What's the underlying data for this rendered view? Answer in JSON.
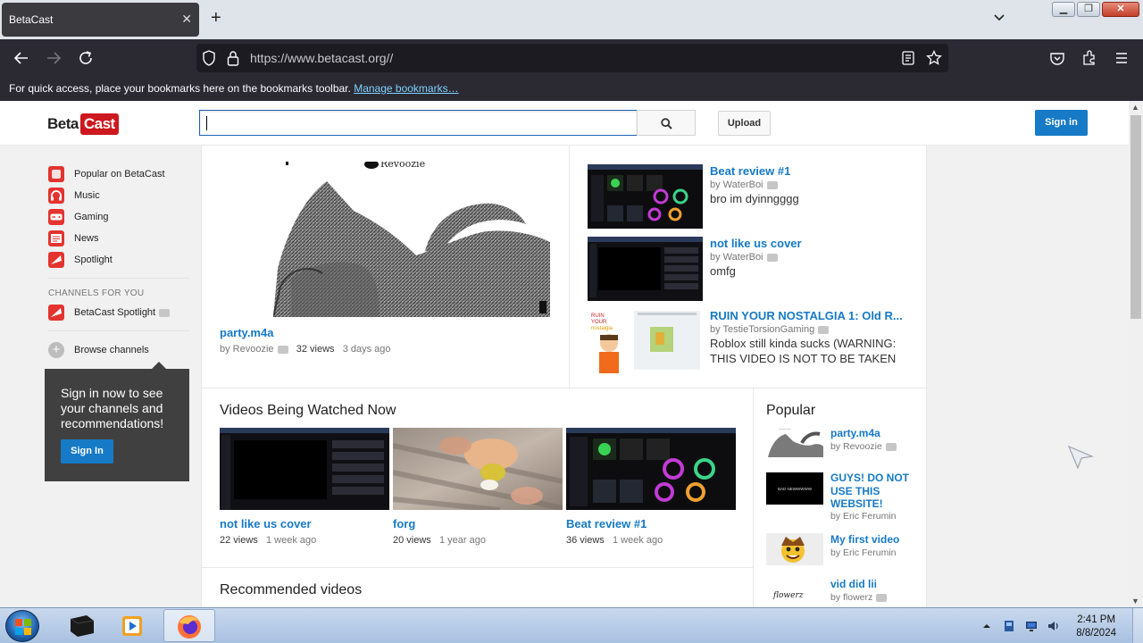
{
  "browser": {
    "tab_title": "BetaCast",
    "tab_close": "✕",
    "new_tab": "+",
    "url": "https://www.betacast.org//",
    "bookmarks_text": "For quick access, place your bookmarks here on the bookmarks toolbar.",
    "bookmarks_link": "Manage bookmarks…"
  },
  "header": {
    "logo_left": "Beta",
    "logo_right": "Cast",
    "search_placeholder": "",
    "upload_label": "Upload",
    "signin_label": "Sign in"
  },
  "guide": {
    "items": [
      {
        "label": "Popular on BetaCast",
        "icon": "popular-icon"
      },
      {
        "label": "Music",
        "icon": "headphones-icon"
      },
      {
        "label": "Gaming",
        "icon": "gamepad-icon"
      },
      {
        "label": "News",
        "icon": "newspaper-icon"
      },
      {
        "label": "Spotlight",
        "icon": "spotlight-icon"
      }
    ],
    "channels_heading": "CHANNELS FOR YOU",
    "channel": "BetaCast Spotlight",
    "browse": "Browse channels",
    "promo_text": "Sign in now to see your channels and recommendations!",
    "promo_button": "Sign In"
  },
  "featured": {
    "title": "party.m4a",
    "by": "by Revoozie",
    "views": "32 views",
    "age": "3 days ago",
    "thumb_text": "Revoozie"
  },
  "side_videos": [
    {
      "title": "Beat review #1",
      "by": "by WaterBoi",
      "desc": "bro im dyinngggg"
    },
    {
      "title": "not like us cover",
      "by": "by WaterBoi",
      "desc": "omfg"
    },
    {
      "title": "RUIN YOUR NOSTALGIA 1: Old R...",
      "by": "by TestieTorsionGaming",
      "desc": "Roblox still kinda sucks (WARNING: THIS VIDEO IS NOT TO BE TAKEN"
    }
  ],
  "watched_now": {
    "heading": "Videos Being Watched Now",
    "items": [
      {
        "title": "not like us cover",
        "views": "22 views",
        "age": "1 week ago"
      },
      {
        "title": "forg",
        "views": "20 views",
        "age": "1 year ago"
      },
      {
        "title": "Beat review #1",
        "views": "36 views",
        "age": "1 week ago"
      }
    ]
  },
  "recommended": {
    "heading": "Recommended videos"
  },
  "popular": {
    "heading": "Popular",
    "items": [
      {
        "title": "party.m4a",
        "by": "by Revoozie"
      },
      {
        "title": "GUYS! DO NOT USE THIS WEBSITE!",
        "by": "by Eric Ferumin",
        "thumb_text": "BAD NEWWWWW"
      },
      {
        "title": "My first video",
        "by": "by Eric Ferumin"
      },
      {
        "title": "vid did lii",
        "by": "by flowerz",
        "thumb_text": "flowerz"
      }
    ]
  },
  "taskbar": {
    "time": "2:41 PM",
    "date": "8/8/2024"
  },
  "colors": {
    "link_blue": "#167ac6",
    "brand_red": "#cc181e",
    "browser_dark": "#2b2a33"
  }
}
